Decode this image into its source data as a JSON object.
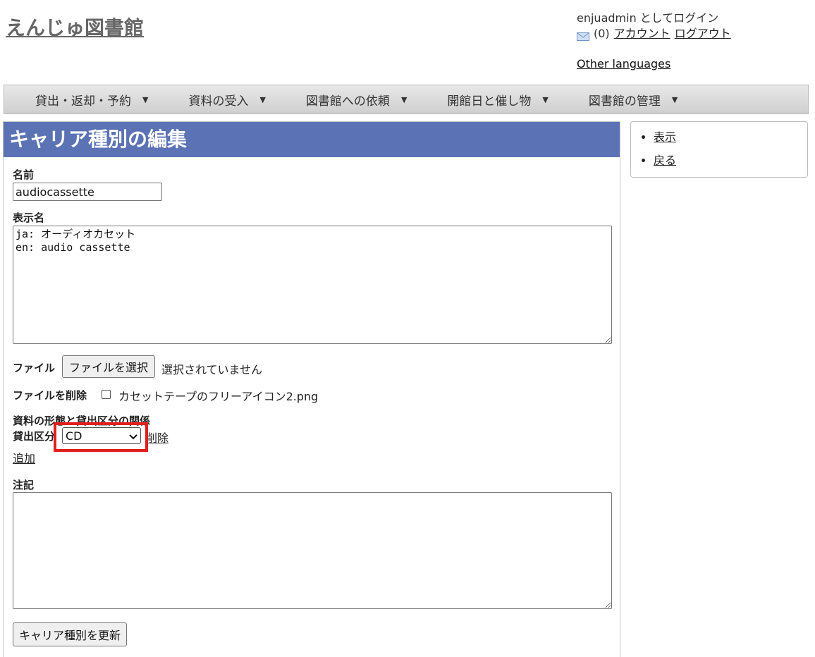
{
  "site": {
    "title": "えんじゅ図書館"
  },
  "user": {
    "login_text": "enjuadmin としてログイン",
    "message_count": "(0)",
    "account_link": "アカウント",
    "logout_link": "ログアウト",
    "other_languages": "Other languages"
  },
  "nav": {
    "items": [
      {
        "label": "貸出・返却・予約"
      },
      {
        "label": "資料の受入"
      },
      {
        "label": "図書館への依頼"
      },
      {
        "label": "開館日と催し物"
      },
      {
        "label": "図書館の管理"
      }
    ]
  },
  "page": {
    "heading": "キャリア種別の編集"
  },
  "form": {
    "name_label": "名前",
    "name_value": "audiocassette",
    "display_name_label": "表示名",
    "display_name_value": "ja: オーディオカセット\nen: audio cassette",
    "file_label": "ファイル",
    "file_button": "ファイルを選択",
    "file_status": "選択されていません",
    "delete_file_label": "ファイルを削除",
    "delete_file_name": "カセットテープのフリーアイコン2.png",
    "relation_heading": "資料の形態と貸出区分の関係",
    "checkout_type_label": "貸出区分",
    "checkout_type_selected": "CD",
    "delete_link": "削除",
    "add_link": "追加",
    "note_label": "注記",
    "note_value": "",
    "submit_button": "キャリア種別を更新"
  },
  "sidebar": {
    "links": [
      {
        "label": "表示"
      },
      {
        "label": "戻る"
      }
    ]
  },
  "colors": {
    "heading_bg": "#5b73b4",
    "highlight": "#e0201e"
  }
}
